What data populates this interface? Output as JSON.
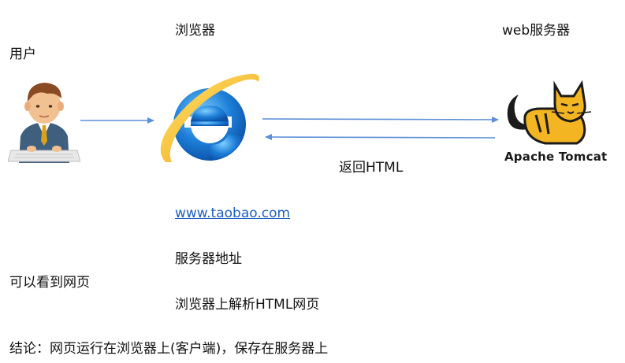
{
  "labels": {
    "user": "用户",
    "browser": "浏览器",
    "web_server": "web服务器",
    "return_html": "返回HTML",
    "url": "www.taobao.com",
    "server_address": "服务器地址",
    "can_see_page": "可以看到网页",
    "browser_parses": "浏览器上解析HTML网页",
    "conclusion": "结论：网页运行在浏览器上(客户端)，保存在服务器上"
  },
  "server_logo": {
    "text": "Apache Tomcat"
  },
  "icons": {
    "user": "user-at-computer-icon",
    "browser": "internet-explorer-icon",
    "server": "apache-tomcat-logo"
  },
  "colors": {
    "arrow": "#5b8fd6",
    "link": "#1f5fbf"
  }
}
